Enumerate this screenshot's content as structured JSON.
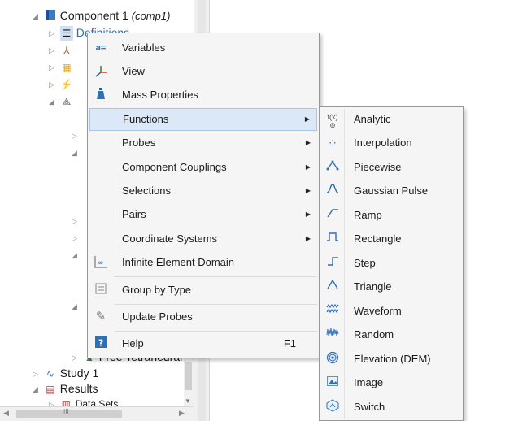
{
  "tree": {
    "component_label": "Component 1",
    "component_tag": "(comp1)",
    "definitions_partial": "Definitions",
    "mesh_partial": "Free Tetrahedral",
    "study_label": "Study 1",
    "results_label": "Results",
    "datasets_label": "Data Sets",
    "scroll_glyph": "III"
  },
  "context_menu": {
    "items": [
      {
        "label": "Variables",
        "icon": "variables-icon"
      },
      {
        "label": "View",
        "icon": "view-axes-icon"
      },
      {
        "label": "Mass Properties",
        "icon": "mass-properties-icon"
      },
      {
        "label": "Functions",
        "icon": "",
        "highlighted": true,
        "submenu": true
      },
      {
        "label": "Probes",
        "icon": "",
        "submenu": true
      },
      {
        "label": "Component Couplings",
        "icon": "",
        "submenu": true
      },
      {
        "label": "Selections",
        "icon": "",
        "submenu": true
      },
      {
        "label": "Pairs",
        "icon": "",
        "submenu": true
      },
      {
        "label": "Coordinate Systems",
        "icon": "",
        "submenu": true
      },
      {
        "label": "Infinite Element Domain",
        "icon": "infinite-element-icon"
      },
      {
        "label": "Group by Type",
        "icon": "group-by-type-icon"
      },
      {
        "label": "Update Probes",
        "icon": "update-probes-icon"
      },
      {
        "label": "Help",
        "icon": "help-icon",
        "shortcut": "F1"
      }
    ]
  },
  "functions_submenu": {
    "items": [
      {
        "label": "Analytic",
        "icon": "analytic-icon",
        "glyph": "f(x)"
      },
      {
        "label": "Interpolation",
        "icon": "interpolation-icon"
      },
      {
        "label": "Piecewise",
        "icon": "piecewise-icon"
      },
      {
        "label": "Gaussian Pulse",
        "icon": "gaussian-pulse-icon"
      },
      {
        "label": "Ramp",
        "icon": "ramp-icon"
      },
      {
        "label": "Rectangle",
        "icon": "rectangle-icon"
      },
      {
        "label": "Step",
        "icon": "step-icon"
      },
      {
        "label": "Triangle",
        "icon": "triangle-icon"
      },
      {
        "label": "Waveform",
        "icon": "waveform-icon"
      },
      {
        "label": "Random",
        "icon": "random-icon"
      },
      {
        "label": "Elevation (DEM)",
        "icon": "elevation-icon"
      },
      {
        "label": "Image",
        "icon": "image-icon"
      },
      {
        "label": "Switch",
        "icon": "switch-icon"
      }
    ]
  },
  "glyphs": {
    "submenu_arrow": "▶",
    "expanded": "◢",
    "collapsed": "▷"
  },
  "colors": {
    "highlight_bg": "#dbe8f7",
    "highlight_border": "#a8c6e8",
    "menu_bg": "#f5f5f5",
    "icon_blue": "#2f6fb5"
  }
}
